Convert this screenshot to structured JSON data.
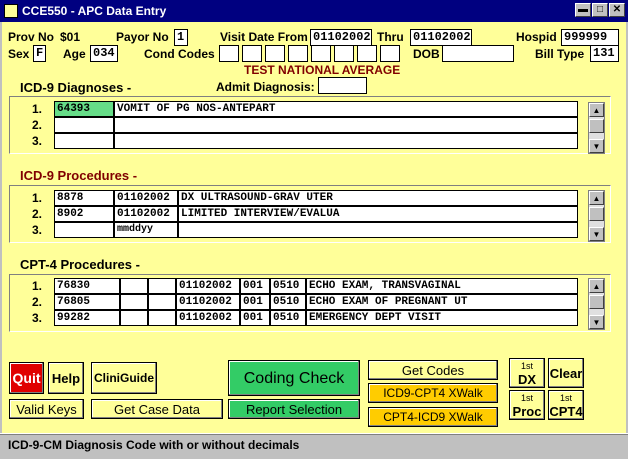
{
  "window": {
    "title": "CCE550 - APC Data Entry"
  },
  "header": {
    "prov_no_label": "Prov No",
    "prov_no_value": "$01",
    "payor_no_label": "Payor No",
    "payor_no_value": "1",
    "visit_from_label": "Visit Date From",
    "visit_from_value": "01102002",
    "thru_label": "Thru",
    "thru_value": "01102002",
    "hospid_label": "Hospid",
    "hospid_value": "999999",
    "sex_label": "Sex",
    "sex_value": "F",
    "age_label": "Age",
    "age_value": "034",
    "cond_codes_label": "Cond Codes",
    "cond_codes": [
      "",
      "",
      "",
      "",
      "",
      "",
      "",
      ""
    ],
    "dob_label": "DOB",
    "dob_value": "",
    "bill_type_label": "Bill Type",
    "bill_type_value": "131",
    "subtitle": "TEST NATIONAL AVERAGE",
    "admit_dx_label": "Admit Diagnosis:",
    "admit_dx_value": ""
  },
  "diagnoses": {
    "title": "ICD-9 Diagnoses -",
    "rows": [
      {
        "num": "1.",
        "code": "64393",
        "desc": "VOMIT OF PG NOS-ANTEPART"
      },
      {
        "num": "2.",
        "code": "",
        "desc": ""
      },
      {
        "num": "3.",
        "code": "",
        "desc": ""
      }
    ]
  },
  "procedures": {
    "title": "ICD-9 Procedures -",
    "rows": [
      {
        "num": "1.",
        "code": "8878",
        "date": "01102002",
        "desc": "DX ULTRASOUND-GRAV UTER"
      },
      {
        "num": "2.",
        "code": "8902",
        "date": "01102002",
        "desc": "LIMITED INTERVIEW/EVALUA"
      },
      {
        "num": "3.",
        "code": "",
        "date": "mmddyy",
        "desc": ""
      }
    ]
  },
  "cpt": {
    "title": "CPT-4 Procedures -",
    "rows": [
      {
        "num": "1.",
        "code": "76830",
        "mod1": "",
        "mod2": "",
        "date": "01102002",
        "units": "001",
        "rev": "0510",
        "desc": "ECHO EXAM, TRANSVAGINAL"
      },
      {
        "num": "2.",
        "code": "76805",
        "mod1": "",
        "mod2": "",
        "date": "01102002",
        "units": "001",
        "rev": "0510",
        "desc": "ECHO EXAM OF PREGNANT UT"
      },
      {
        "num": "3.",
        "code": "99282",
        "mod1": "",
        "mod2": "",
        "date": "01102002",
        "units": "001",
        "rev": "0510",
        "desc": "EMERGENCY DEPT VISIT"
      }
    ]
  },
  "buttons": {
    "quit": "Quit",
    "help": "Help",
    "cliniguide": "CliniGuide",
    "coding_check": "Coding Check",
    "get_codes": "Get Codes",
    "first_dx_top": "1st",
    "first_dx_bottom": "DX",
    "clear": "Clear",
    "valid_keys": "Valid Keys",
    "get_case_data": "Get Case Data",
    "report_selection": "Report Selection",
    "icd9_cpt4": "ICD9-CPT4 XWalk",
    "cpt4_icd9": "CPT4-ICD9 XWalk",
    "first_proc_top": "1st",
    "first_proc_bottom": "Proc",
    "first_cpt4_top": "1st",
    "first_cpt4_bottom": "CPT4"
  },
  "status": {
    "text": "ICD-9-CM Diagnosis Code with or without decimals"
  },
  "colors": {
    "background": "#ffff99",
    "titlebar": "#000080",
    "accent_green": "#33cc66",
    "accent_red": "#e00000",
    "accent_orange": "#ffcc00",
    "subtitle": "#800000"
  }
}
